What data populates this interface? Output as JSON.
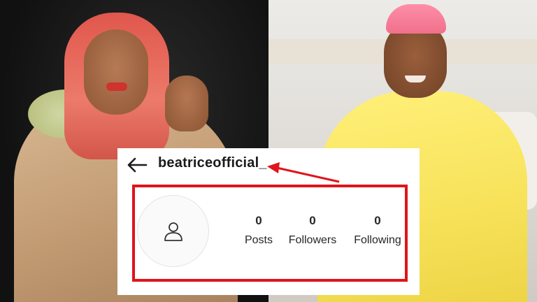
{
  "profile": {
    "username": "beatriceofficial_",
    "stats": [
      {
        "count": "0",
        "label": "Posts"
      },
      {
        "count": "0",
        "label": "Followers"
      },
      {
        "count": "0",
        "label": "Following"
      }
    ]
  },
  "icons": {
    "back": "arrow-left-icon",
    "avatar": "user-placeholder-icon",
    "annotation": "red-arrow"
  },
  "colors": {
    "highlight": "#e0141b",
    "card_background": "#ffffff",
    "text": "#262626"
  }
}
